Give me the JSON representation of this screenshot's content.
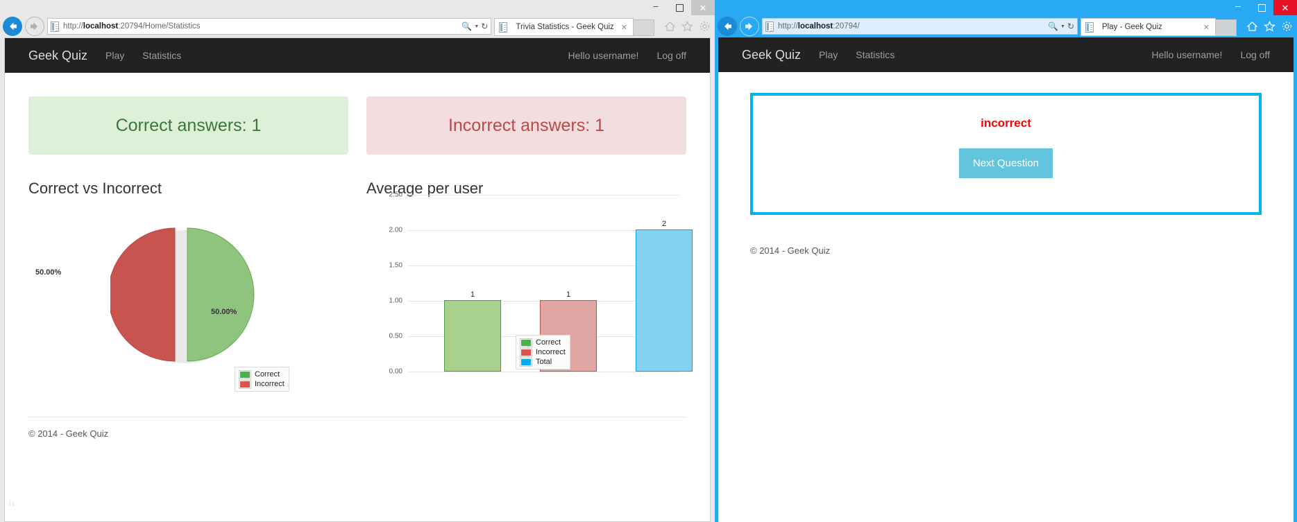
{
  "windows": {
    "statistics": {
      "titlebar": {
        "minimize_label": "–",
        "maximize_label": "□",
        "close_label": "✕"
      },
      "address": {
        "url_prefix": "http://",
        "url_host": "localhost",
        "url_suffix": ":20794/Home/Statistics",
        "search_icon": "search-icon",
        "caret_icon": "chevron-down-icon",
        "refresh_icon": "refresh-icon"
      },
      "tab": {
        "title": "Trivia Statistics - Geek Quiz",
        "close_label": "✕"
      },
      "ie_tools": [
        "home-icon",
        "favorites-star-icon",
        "settings-gear-icon"
      ],
      "site_nav": {
        "brand": "Geek Quiz",
        "links": [
          "Play",
          "Statistics"
        ],
        "right_links": [
          "Hello username!",
          "Log off"
        ]
      },
      "panels": [
        {
          "label": "Correct answers: 1",
          "type": "correct"
        },
        {
          "label": "Incorrect answers: 1",
          "type": "incorrect"
        }
      ],
      "footer": "© 2014 - Geek Quiz"
    },
    "play": {
      "titlebar": {
        "minimize_label": "–",
        "maximize_label": "□",
        "close_label": "✕"
      },
      "address": {
        "url_prefix": "http://",
        "url_host": "localhost",
        "url_suffix": ":20794/",
        "search_icon": "search-icon",
        "caret_icon": "chevron-down-icon",
        "refresh_icon": "refresh-icon"
      },
      "tab": {
        "title": "Play - Geek Quiz",
        "close_label": "✕"
      },
      "ie_tools": [
        "home-icon",
        "favorites-star-icon",
        "settings-gear-icon"
      ],
      "site_nav": {
        "brand": "Geek Quiz",
        "links": [
          "Play",
          "Statistics"
        ],
        "right_links": [
          "Hello username!",
          "Log off"
        ]
      },
      "result_text": "incorrect",
      "next_button": "Next Question",
      "footer": "© 2014 - Geek Quiz"
    }
  },
  "colors": {
    "correct_green": "#5cb85c",
    "incorrect_red": "#d9534f",
    "total_blue": "#29abe2",
    "panel_green_bg": "#dff0d8",
    "panel_green_text": "#3c763d",
    "panel_red_bg": "#f2dede",
    "panel_red_text": "#b94a48",
    "navbar_dark": "#222222",
    "accent_cyan": "#00b3ec",
    "button_blue": "#62c5dd",
    "result_red": "#ff0000"
  },
  "chart_data": [
    {
      "type": "pie",
      "title": "Correct vs Incorrect",
      "categories": [
        "Correct",
        "Incorrect"
      ],
      "values": [
        50.0,
        50.0
      ],
      "labels": [
        "50.00%",
        "50.00%"
      ],
      "colors": [
        "#6aa84f",
        "#c9534f"
      ],
      "legend": [
        "Correct",
        "Incorrect"
      ],
      "legend_position": "bottom-right",
      "exploded": true
    },
    {
      "type": "bar",
      "title": "Average per user",
      "categories": [
        "Correct",
        "Incorrect",
        "Total"
      ],
      "values": [
        1,
        1,
        2
      ],
      "value_labels": [
        "1",
        "1",
        "2"
      ],
      "colors": [
        "#a9d18e",
        "#dfa6a4",
        "#84d1f0"
      ],
      "border_colors": [
        "#4e9a3f",
        "#c0504d",
        "#00a2e8"
      ],
      "legend": [
        "Correct",
        "Incorrect",
        "Total"
      ],
      "legend_position": "bottom-right",
      "ylim": [
        0,
        2.5
      ],
      "yticks": [
        "0.00",
        "0.50",
        "1.00",
        "1.50",
        "2.00",
        "2.50"
      ],
      "ytick_values": [
        0,
        0.5,
        1.0,
        1.5,
        2.0,
        2.5
      ],
      "xlabel": "",
      "ylabel": "",
      "grid": true
    }
  ]
}
